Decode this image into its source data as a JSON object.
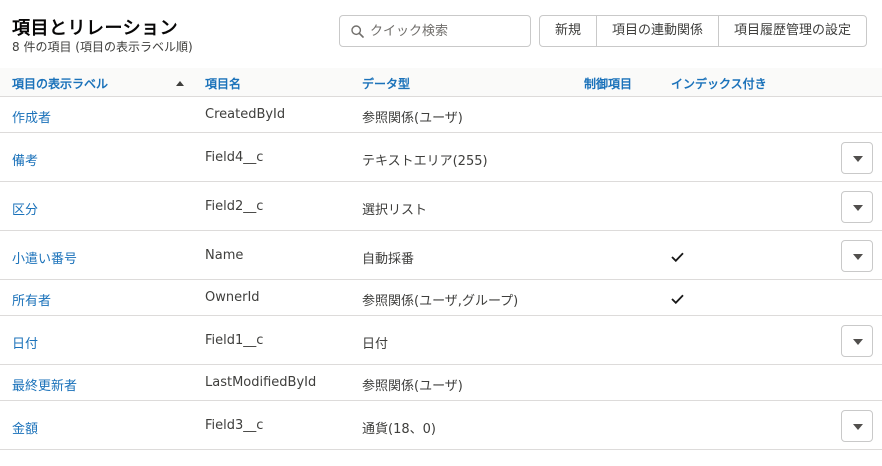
{
  "header": {
    "title": "項目とリレーション",
    "subtitle": "8 件の項目 (項目の表示ラベル順)",
    "search_placeholder": "クイック検索",
    "buttons": [
      "新規",
      "項目の連動関係",
      "項目履歴管理の設定"
    ]
  },
  "table": {
    "columns": [
      "項目の表示ラベル",
      "項目名",
      "データ型",
      "制御項目",
      "インデックス付き"
    ],
    "sort": {
      "column": "項目の表示ラベル",
      "direction": "ascending"
    },
    "rows": [
      {
        "label": "作成者",
        "api": "CreatedById",
        "type": "参照関係(ユーザ)",
        "indexed": false,
        "menu": false
      },
      {
        "label": "備考",
        "api": "Field4__c",
        "type": "テキストエリア(255)",
        "indexed": false,
        "menu": true
      },
      {
        "label": "区分",
        "api": "Field2__c",
        "type": "選択リスト",
        "indexed": false,
        "menu": true
      },
      {
        "label": "小遣い番号",
        "api": "Name",
        "type": "自動採番",
        "indexed": true,
        "menu": true
      },
      {
        "label": "所有者",
        "api": "OwnerId",
        "type": "参照関係(ユーザ,グループ)",
        "indexed": true,
        "menu": false
      },
      {
        "label": "日付",
        "api": "Field1__c",
        "type": "日付",
        "indexed": false,
        "menu": true
      },
      {
        "label": "最終更新者",
        "api": "LastModifiedById",
        "type": "参照関係(ユーザ)",
        "indexed": false,
        "menu": false
      },
      {
        "label": "金額",
        "api": "Field3__c",
        "type": "通貨(18、0)",
        "indexed": false,
        "menu": true
      }
    ]
  },
  "icons": {
    "search": "search-icon",
    "sort": "sort-ascending-icon",
    "check": "checkmark-icon",
    "row_menu": "chevron-down-icon"
  },
  "colors": {
    "link": "#1b72ba",
    "header_bg": "#fafaf9",
    "border": "#dddbda"
  }
}
